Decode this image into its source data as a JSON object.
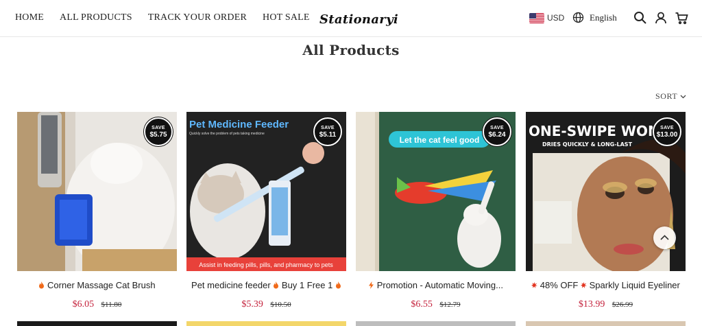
{
  "header": {
    "nav": [
      "HOME",
      "ALL PRODUCTS",
      "TRACK YOUR ORDER",
      "HOT SALE"
    ],
    "logo": "Stationaryi",
    "currency": "USD",
    "language": "English",
    "icons": [
      "us-flag-icon",
      "globe-icon",
      "search-icon",
      "account-icon",
      "cart-icon"
    ]
  },
  "main": {
    "title": "All Products",
    "sort_label": "SORT"
  },
  "products": [
    {
      "save_label": "SAVE",
      "save_amount": "$5.75",
      "title": "Corner Massage Cat Brush",
      "title_prefix_icon": "fire",
      "price": "$6.05",
      "old_price": "$11.80"
    },
    {
      "save_label": "SAVE",
      "save_amount": "$5.11",
      "title": "Pet medicine feeder",
      "title_suffix": "Buy 1 Free 1",
      "title_icons": [
        "fire",
        "fire"
      ],
      "price": "$5.39",
      "old_price": "$10.50",
      "image_text_top": "Pet Medicine Feeder",
      "image_text_sub": "Quickly solve the problem of pets taking medicine",
      "image_text_bottom": "Assist in feeding pills, pills, and pharmacy to pets"
    },
    {
      "save_label": "SAVE",
      "save_amount": "$6.24",
      "title": "Promotion - Automatic Moving...",
      "title_prefix_icon": "lightning",
      "price": "$6.55",
      "old_price": "$12.79",
      "image_text_top": "Let the cat feel good"
    },
    {
      "save_label": "SAVE",
      "save_amount": "$13.00",
      "title": "48% OFF",
      "title_suffix": "Sparkly Liquid Eyeliner",
      "title_icons": [
        "burst",
        "burst"
      ],
      "price": "$13.99",
      "old_price": "$26.99",
      "image_text_top": "ONE-SWIPE WONDE",
      "image_text_sub": "DRIES QUICKLY & LONG-LAST"
    }
  ],
  "colors": {
    "price": "#c4213b",
    "badge": "#111111"
  }
}
